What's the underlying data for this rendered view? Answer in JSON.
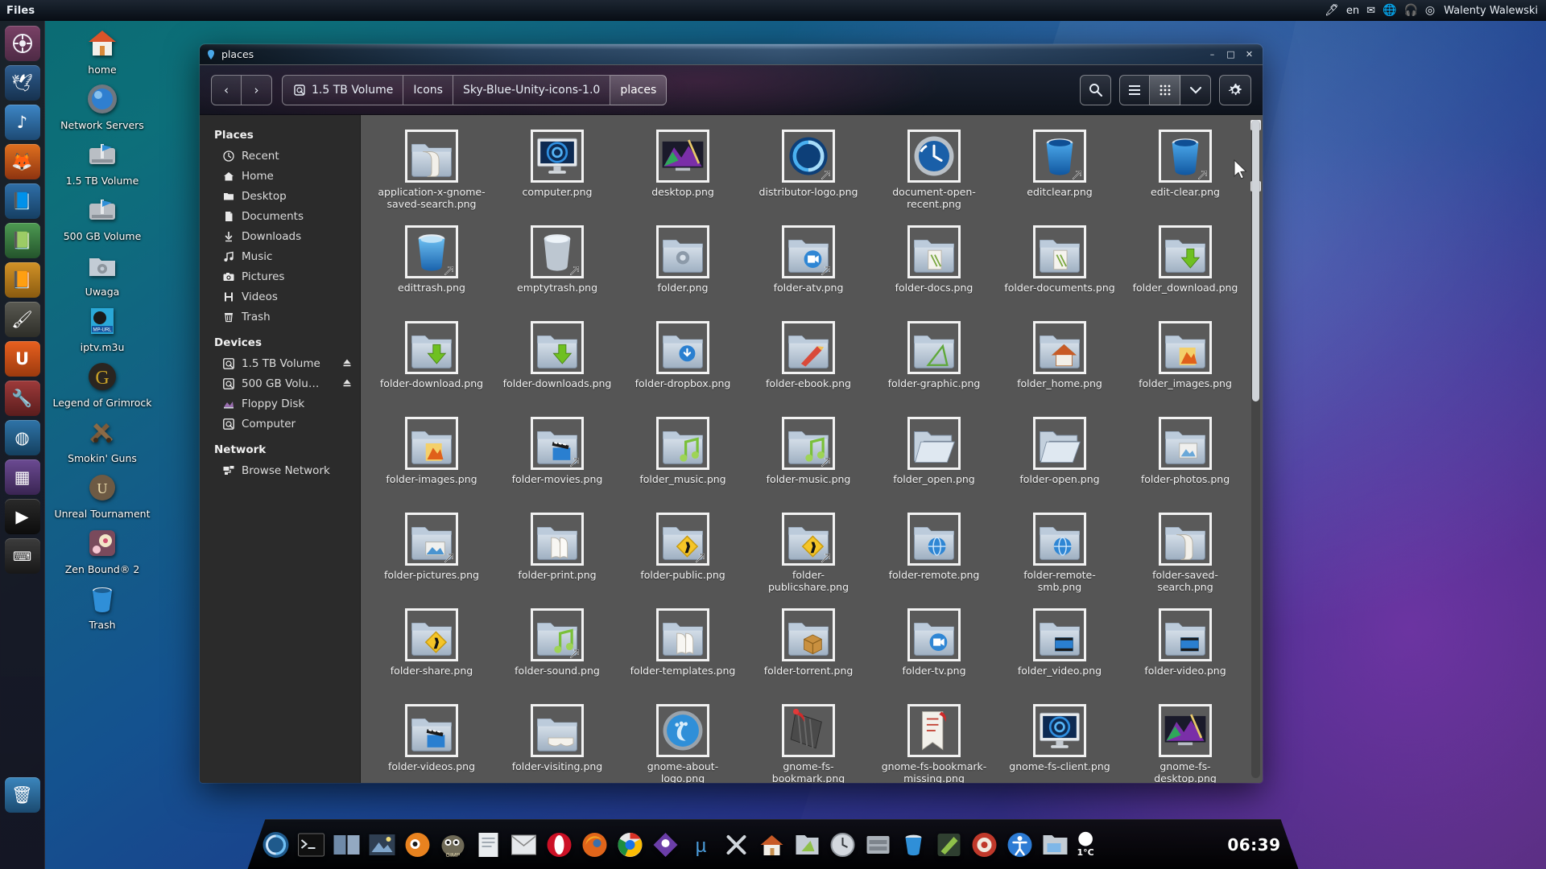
{
  "top_panel": {
    "app_title": "Files",
    "tray": [
      {
        "name": "usb-icon",
        "glyph": "🖊"
      },
      {
        "name": "keyboard-layout",
        "label": "en"
      },
      {
        "name": "mail-icon",
        "glyph": "✉"
      },
      {
        "name": "network-icon",
        "glyph": "🌐"
      },
      {
        "name": "sound-icon",
        "glyph": "🎵"
      },
      {
        "name": "session-icon",
        "glyph": "◎"
      }
    ],
    "user_name": "Walenty Walewski"
  },
  "launcher": {
    "items": [
      {
        "name": "dash-home",
        "glyph": "◉",
        "color": "#6f3b5e"
      },
      {
        "name": "thunderbird",
        "glyph": "🕊",
        "color": "#2b4a6e"
      },
      {
        "name": "rhythmbox",
        "glyph": "♪",
        "color": "#2a5a86"
      },
      {
        "name": "firefox",
        "glyph": "🦊",
        "color": "#a5441a"
      },
      {
        "name": "libreoffice-writer",
        "glyph": "📘",
        "color": "#1f4f7a"
      },
      {
        "name": "libreoffice-calc",
        "glyph": "📗",
        "color": "#2e6b3f"
      },
      {
        "name": "libreoffice-impress",
        "glyph": "📙",
        "color": "#9c6418"
      },
      {
        "name": "gimp-launcher",
        "glyph": "🎨",
        "color": "#3a3a3a"
      },
      {
        "name": "ubuntu-software",
        "glyph": "U",
        "color": "#d9511c"
      },
      {
        "name": "system-settings",
        "glyph": "🔧",
        "color": "#8b2f2f"
      },
      {
        "name": "web-browser",
        "glyph": "◍",
        "color": "#26567e"
      },
      {
        "name": "workspace-switcher",
        "glyph": "▦",
        "color": "#5a3f7a"
      },
      {
        "name": "terminal-launcher",
        "glyph": "▶",
        "color": "#1a1a1a"
      },
      {
        "name": "keyboard-launcher",
        "glyph": "⌨",
        "color": "#2f2f2f"
      },
      {
        "name": "trash-launcher",
        "glyph": "🗑",
        "color": "#2a5f86"
      }
    ]
  },
  "desktop_icons": [
    {
      "name": "desktop-icon-home",
      "label": "home",
      "glyph": "🏠"
    },
    {
      "name": "desktop-icon-network-servers",
      "label": "Network Servers",
      "glyph": "🌐"
    },
    {
      "name": "desktop-icon-15tb-volume",
      "label": "1.5 TB Volume",
      "glyph": "💾"
    },
    {
      "name": "desktop-icon-500gb-volume",
      "label": "500 GB Volume",
      "glyph": "💾"
    },
    {
      "name": "desktop-icon-uwaga",
      "label": "Uwaga",
      "glyph": "📁"
    },
    {
      "name": "desktop-icon-iptv",
      "label": "iptv.m3u",
      "glyph": "🎬"
    },
    {
      "name": "desktop-icon-legend-of-grimrock",
      "label": "Legend of Grimrock",
      "glyph": "🜲"
    },
    {
      "name": "desktop-icon-smokin-guns",
      "label": "Smokin' Guns",
      "glyph": "🔫"
    },
    {
      "name": "desktop-icon-unreal-tournament",
      "label": "Unreal Tournament",
      "glyph": "🏆"
    },
    {
      "name": "desktop-icon-zen-bound-2",
      "label": "Zen Bound® 2",
      "glyph": "🌸"
    },
    {
      "name": "desktop-icon-trash",
      "label": "Trash",
      "glyph": "🗑"
    }
  ],
  "window": {
    "title": "places",
    "icon": "places-window-icon",
    "buttons": {
      "minimize": "–",
      "maximize": "□",
      "close": "✕"
    }
  },
  "toolbar": {
    "back_label": "‹",
    "forward_label": "›",
    "breadcrumbs": [
      {
        "name": "breadcrumb-15tb-volume",
        "label": "1.5 TB Volume",
        "icon": "drive-icon",
        "current": false
      },
      {
        "name": "breadcrumb-icons",
        "label": "Icons",
        "icon": "",
        "current": false
      },
      {
        "name": "breadcrumb-sky-blue-unity-icons",
        "label": "Sky-Blue-Unity-icons-1.0",
        "icon": "",
        "current": false
      },
      {
        "name": "breadcrumb-places",
        "label": "places",
        "icon": "",
        "current": true
      }
    ],
    "search_label": "⌕",
    "list_view_label": "≡",
    "grid_view_label": "∷",
    "view_options_label": "⌄",
    "settings_label": "⚙"
  },
  "sidebar": {
    "sections": [
      {
        "name": "sidebar-section-places",
        "heading": "Places",
        "items": [
          {
            "name": "sidebar-item-recent",
            "label": "Recent",
            "icon": "clock-icon",
            "glyph": "◴",
            "eject": false
          },
          {
            "name": "sidebar-item-home",
            "label": "Home",
            "icon": "home-icon",
            "glyph": "⌂",
            "eject": false
          },
          {
            "name": "sidebar-item-desktop",
            "label": "Desktop",
            "icon": "folder-icon",
            "glyph": "▰",
            "eject": false
          },
          {
            "name": "sidebar-item-documents",
            "label": "Documents",
            "icon": "document-icon",
            "glyph": "☰",
            "eject": false
          },
          {
            "name": "sidebar-item-downloads",
            "label": "Downloads",
            "icon": "download-icon",
            "glyph": "↓",
            "eject": false
          },
          {
            "name": "sidebar-item-music",
            "label": "Music",
            "icon": "music-icon",
            "glyph": "♫",
            "eject": false
          },
          {
            "name": "sidebar-item-pictures",
            "label": "Pictures",
            "icon": "camera-icon",
            "glyph": "◉",
            "eject": false
          },
          {
            "name": "sidebar-item-videos",
            "label": "Videos",
            "icon": "film-icon",
            "glyph": "⬚",
            "eject": false
          },
          {
            "name": "sidebar-item-trash",
            "label": "Trash",
            "icon": "trash-icon",
            "glyph": "ᴛ",
            "eject": false
          }
        ]
      },
      {
        "name": "sidebar-section-devices",
        "heading": "Devices",
        "items": [
          {
            "name": "sidebar-item-15tb-volume",
            "label": "1.5 TB Volume",
            "icon": "drive-icon",
            "glyph": "▣",
            "eject": true
          },
          {
            "name": "sidebar-item-500gb-volume",
            "label": "500 GB Volu…",
            "icon": "drive-icon",
            "glyph": "▣",
            "eject": true
          },
          {
            "name": "sidebar-item-floppy-disk",
            "label": "Floppy Disk",
            "icon": "floppy-icon",
            "glyph": "◩",
            "eject": false
          },
          {
            "name": "sidebar-item-computer",
            "label": "Computer",
            "icon": "computer-icon",
            "glyph": "▣",
            "eject": false
          }
        ]
      },
      {
        "name": "sidebar-section-network",
        "heading": "Network",
        "items": [
          {
            "name": "sidebar-item-browse-network",
            "label": "Browse Network",
            "icon": "network-icon",
            "glyph": "⚇",
            "eject": false
          }
        ]
      }
    ]
  },
  "files": [
    {
      "name": "application-x-gnome-saved-search.png",
      "kind": "folder-scroll",
      "emblem": false
    },
    {
      "name": "computer.png",
      "kind": "monitor",
      "emblem": false
    },
    {
      "name": "desktop.png",
      "kind": "desktop-art",
      "emblem": false
    },
    {
      "name": "distributor-logo.png",
      "kind": "distributor",
      "emblem": true
    },
    {
      "name": "document-open-recent.png",
      "kind": "clock-disc",
      "emblem": false
    },
    {
      "name": "editclear.png",
      "kind": "bin",
      "emblem": true
    },
    {
      "name": "edit-clear.png",
      "kind": "bin",
      "emblem": true
    },
    {
      "name": "edittrash.png",
      "kind": "bin-full",
      "emblem": true
    },
    {
      "name": "emptytrash.png",
      "kind": "bin-empty",
      "emblem": true
    },
    {
      "name": "folder.png",
      "kind": "folder-gear",
      "emblem": false
    },
    {
      "name": "folder-atv.png",
      "kind": "folder-tv",
      "emblem": true
    },
    {
      "name": "folder-docs.png",
      "kind": "folder-docs",
      "emblem": false
    },
    {
      "name": "folder-documents.png",
      "kind": "folder-docs",
      "emblem": false
    },
    {
      "name": "folder_download.png",
      "kind": "folder-down",
      "emblem": false
    },
    {
      "name": "folder-download.png",
      "kind": "folder-down",
      "emblem": false
    },
    {
      "name": "folder-downloads.png",
      "kind": "folder-down",
      "emblem": false
    },
    {
      "name": "folder-dropbox.png",
      "kind": "folder-dropbox",
      "emblem": false
    },
    {
      "name": "folder-ebook.png",
      "kind": "folder-ebook",
      "emblem": false
    },
    {
      "name": "folder-graphic.png",
      "kind": "folder-graphic",
      "emblem": false
    },
    {
      "name": "folder_home.png",
      "kind": "folder-home",
      "emblem": false
    },
    {
      "name": "folder_images.png",
      "kind": "folder-images",
      "emblem": false
    },
    {
      "name": "folder-images.png",
      "kind": "folder-images",
      "emblem": false
    },
    {
      "name": "folder-movies.png",
      "kind": "folder-movie",
      "emblem": true
    },
    {
      "name": "folder_music.png",
      "kind": "folder-music",
      "emblem": false
    },
    {
      "name": "folder-music.png",
      "kind": "folder-music",
      "emblem": true
    },
    {
      "name": "folder_open.png",
      "kind": "folder-open",
      "emblem": false
    },
    {
      "name": "folder-open.png",
      "kind": "folder-open",
      "emblem": false
    },
    {
      "name": "folder-photos.png",
      "kind": "folder-photos",
      "emblem": false
    },
    {
      "name": "folder-pictures.png",
      "kind": "folder-picture",
      "emblem": true
    },
    {
      "name": "folder-print.png",
      "kind": "folder-print",
      "emblem": false
    },
    {
      "name": "folder-public.png",
      "kind": "folder-public",
      "emblem": true
    },
    {
      "name": "folder-publicshare.png",
      "kind": "folder-public",
      "emblem": true
    },
    {
      "name": "folder-remote.png",
      "kind": "folder-remote",
      "emblem": false
    },
    {
      "name": "folder-remote-smb.png",
      "kind": "folder-remote",
      "emblem": false
    },
    {
      "name": "folder-saved-search.png",
      "kind": "folder-scroll",
      "emblem": false
    },
    {
      "name": "folder-share.png",
      "kind": "folder-public",
      "emblem": false
    },
    {
      "name": "folder-sound.png",
      "kind": "folder-music",
      "emblem": true
    },
    {
      "name": "folder-templates.png",
      "kind": "folder-print",
      "emblem": false
    },
    {
      "name": "folder-torrent.png",
      "kind": "folder-torrent",
      "emblem": false
    },
    {
      "name": "folder-tv.png",
      "kind": "folder-tv",
      "emblem": false
    },
    {
      "name": "folder_video.png",
      "kind": "folder-video",
      "emblem": false
    },
    {
      "name": "folder-video.png",
      "kind": "folder-video",
      "emblem": false
    },
    {
      "name": "folder-videos.png",
      "kind": "folder-movie",
      "emblem": false
    },
    {
      "name": "folder-visiting.png",
      "kind": "folder-visiting",
      "emblem": false
    },
    {
      "name": "gnome-about-logo.png",
      "kind": "gnome-logo",
      "emblem": false
    },
    {
      "name": "gnome-fs-bookmark.png",
      "kind": "bookmark",
      "emblem": false
    },
    {
      "name": "gnome-fs-bookmark-missing.png",
      "kind": "bookmark-missing",
      "emblem": false
    },
    {
      "name": "gnome-fs-client.png",
      "kind": "monitor",
      "emblem": false
    },
    {
      "name": "gnome-fs-desktop.png",
      "kind": "desktop-art",
      "emblem": false
    }
  ],
  "dock": {
    "items": [
      {
        "name": "dock-midori",
        "glyph": "◍",
        "color": "#1f5a8c"
      },
      {
        "name": "dock-terminal",
        "glyph": "▶",
        "color": "#101010"
      },
      {
        "name": "dock-gnome-commander",
        "glyph": "▤",
        "color": "#3f5a80"
      },
      {
        "name": "dock-pictures-app",
        "glyph": "🖼",
        "color": "#2f3f52"
      },
      {
        "name": "dock-blender",
        "glyph": "◉",
        "color": "#d97b1f"
      },
      {
        "name": "dock-gimp",
        "glyph": "🖌",
        "color": "#4a4a42"
      },
      {
        "name": "dock-documents",
        "glyph": "📄",
        "color": "#b9bcc2"
      },
      {
        "name": "dock-mail",
        "glyph": "✉",
        "color": "#8f8f8f"
      },
      {
        "name": "dock-opera",
        "glyph": "O",
        "color": "#cc1126"
      },
      {
        "name": "dock-firefox",
        "glyph": "🦊",
        "color": "#e0651a"
      },
      {
        "name": "dock-chrome",
        "glyph": "◯",
        "color": "#3a8cdf"
      },
      {
        "name": "dock-pidgin",
        "glyph": "◆",
        "color": "#5b3ea8"
      },
      {
        "name": "dock-utorrent",
        "glyph": "µ",
        "color": "#2e6fa5"
      },
      {
        "name": "dock-crossover",
        "glyph": "✕",
        "color": "#2a2a2a"
      },
      {
        "name": "dock-home-folder",
        "glyph": "🏠",
        "color": "#c0622a"
      },
      {
        "name": "dock-graphics",
        "glyph": "◣",
        "color": "#8fb35e"
      },
      {
        "name": "dock-clock-app",
        "glyph": "◷",
        "color": "#c3c7cc"
      },
      {
        "name": "dock-archive",
        "glyph": "🗄",
        "color": "#9aa0a8"
      },
      {
        "name": "dock-trash",
        "glyph": "🗑",
        "color": "#2f7fb8"
      },
      {
        "name": "dock-paint",
        "glyph": "✎",
        "color": "#6fb04a"
      },
      {
        "name": "dock-target",
        "glyph": "◎",
        "color": "#c0392b"
      },
      {
        "name": "dock-accessibility",
        "glyph": "♿",
        "color": "#2d7bd4"
      },
      {
        "name": "dock-files",
        "glyph": "🗂",
        "color": "#aeb4bb"
      }
    ],
    "clock": "06:39",
    "temperature": "1°C",
    "weather_icon": "moon-icon"
  }
}
